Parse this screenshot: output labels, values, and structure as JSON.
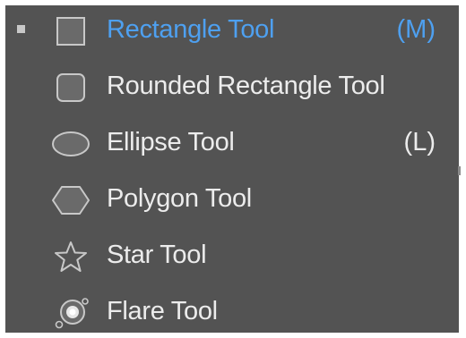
{
  "colors": {
    "panel_background": "#535353",
    "label_text": "#ececec",
    "selected_text": "#4ea0f0",
    "icon_stroke": "#c8c8c8",
    "icon_fill": "#6a6a6a"
  },
  "flyout": {
    "items": [
      {
        "label": "Rectangle Tool",
        "shortcut": "(M)",
        "icon": "rectangle-icon",
        "selected": true
      },
      {
        "label": "Rounded Rectangle Tool",
        "shortcut": "",
        "icon": "rounded-rectangle-icon",
        "selected": false
      },
      {
        "label": "Ellipse Tool",
        "shortcut": "(L)",
        "icon": "ellipse-icon",
        "selected": false
      },
      {
        "label": "Polygon Tool",
        "shortcut": "",
        "icon": "polygon-icon",
        "selected": false
      },
      {
        "label": "Star Tool",
        "shortcut": "",
        "icon": "star-icon",
        "selected": false
      },
      {
        "label": "Flare Tool",
        "shortcut": "",
        "icon": "flare-icon",
        "selected": false
      }
    ]
  }
}
